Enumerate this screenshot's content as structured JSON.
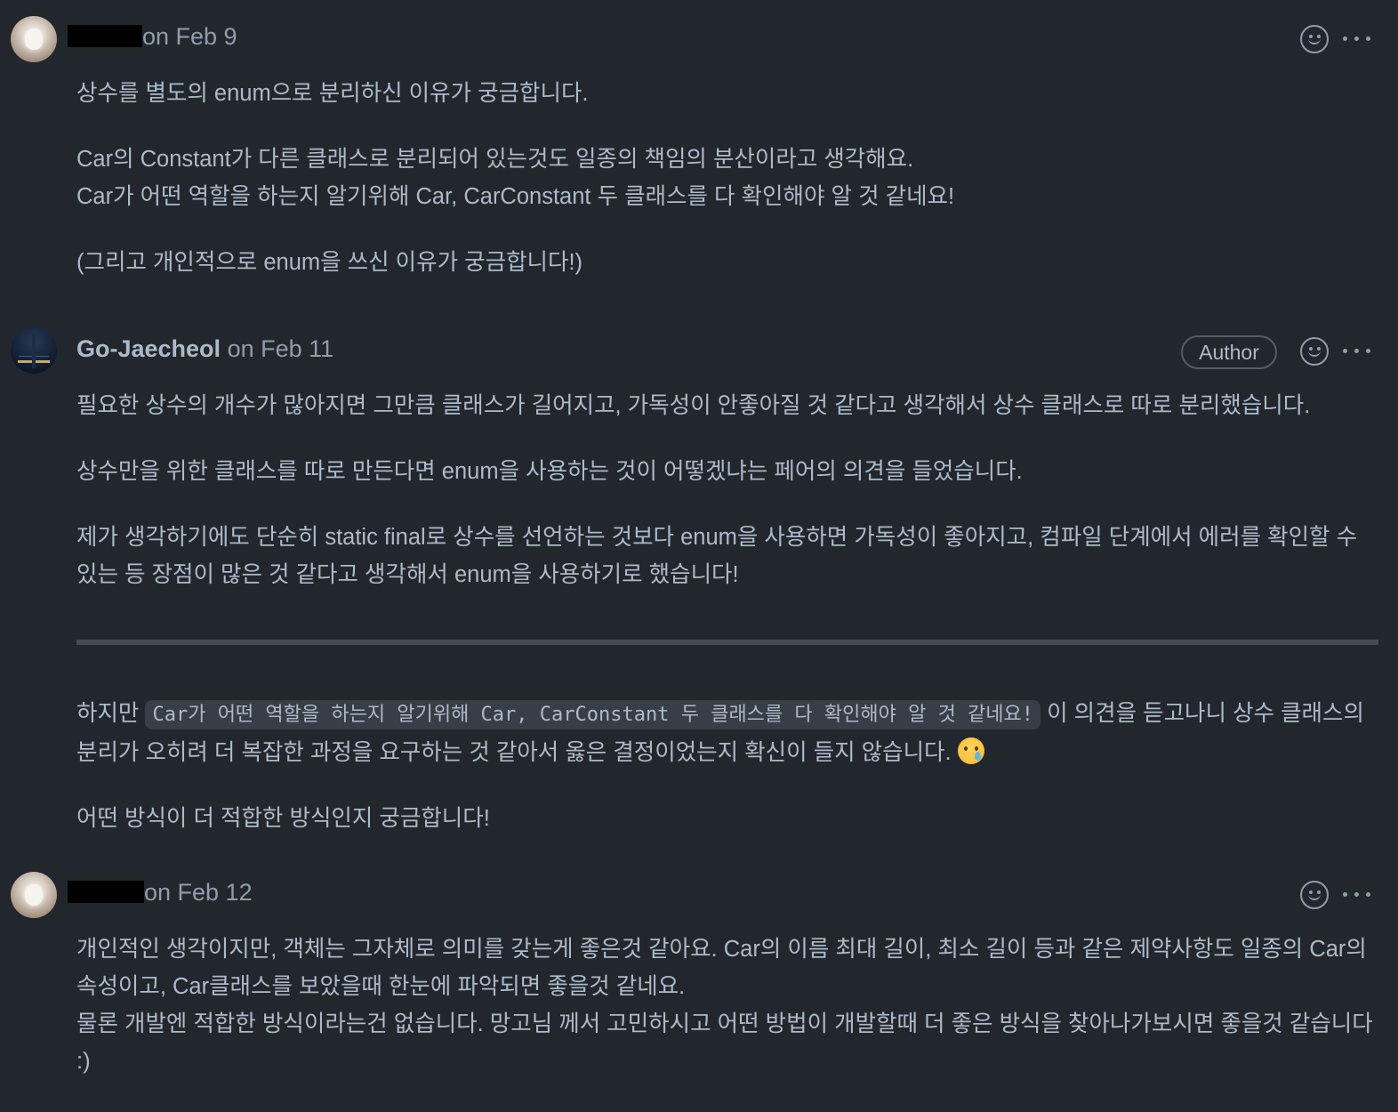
{
  "comments": [
    {
      "author": "",
      "date": "on Feb 9",
      "paragraphs": [
        [
          "상수를 별도의 enum으로 분리하신 이유가 궁금합니다."
        ],
        [
          "Car의 Constant가 다른 클래스로 분리되어 있는것도 일종의 책임의 분산이라고 생각해요.",
          "Car가 어떤 역할을 하는지 알기위해 Car, CarConstant 두 클래스를 다 확인해야 알 것 같네요!"
        ],
        [
          "(그리고 개인적으로 enum을 쓰신 이유가 궁금합니다!)"
        ]
      ]
    },
    {
      "author": "Go-Jaecheol",
      "date": "on Feb 11",
      "badge": "Author",
      "paragraphs_before_rule": [
        "필요한 상수의 개수가 많아지면 그만큼 클래스가 길어지고, 가독성이 안좋아질 것 같다고 생각해서 상수 클래스로 따로 분리했습니다.",
        "상수만을 위한 클래스를 따로 만든다면 enum을 사용하는 것이 어떻겠냐는 페어의 의견을 들었습니다.",
        "제가 생각하기에도 단순히 static final로 상수를 선언하는 것보다 enum을 사용하면 가독성이 좋아지고, 컴파일 단계에서 에러를 확인할 수 있는 등 장점이 많은 것 같다고 생각해서 enum을 사용하기로 했습니다!"
      ],
      "quote_prefix": "하지만 ",
      "quote_code": "Car가 어떤 역할을 하는지 알기위해 Car, CarConstant 두 클래스를 다 확인해야 알 것 같네요!",
      "quote_suffix": " 이 의견을 듣고나니 상수 클래스의 분리가 오히려 더 복잡한 과정을 요구하는 것 같아서 옳은 결정이었는지 확신이 들지 않습니다. ",
      "emoji": "crying-face",
      "closing": "어떤 방식이 더 적합한 방식인지 궁금합니다!"
    },
    {
      "author": "",
      "date": "on Feb 12",
      "lines": [
        "개인적인 생각이지만, 객체는 그자체로 의미를 갖는게 좋은것 같아요. Car의 이름 최대 길이, 최소 길이 등과 같은 제약사항도 일종의 Car의 속성이고, Car클래스를 보았을때 한눈에 파악되면 좋을것 같네요.",
        "물론 개발엔 적합한 방식이라는건 없습니다. 망고님 께서 고민하시고 어떤 방법이 개발할때 더 좋은 방식을 찾아나가보시면 좋을것 같습니다 :)"
      ]
    }
  ],
  "colors": {
    "background": "#22272e",
    "text": "#adbac7",
    "muted": "#909dab",
    "border": "#444c56",
    "code_bg": "#373e47"
  }
}
